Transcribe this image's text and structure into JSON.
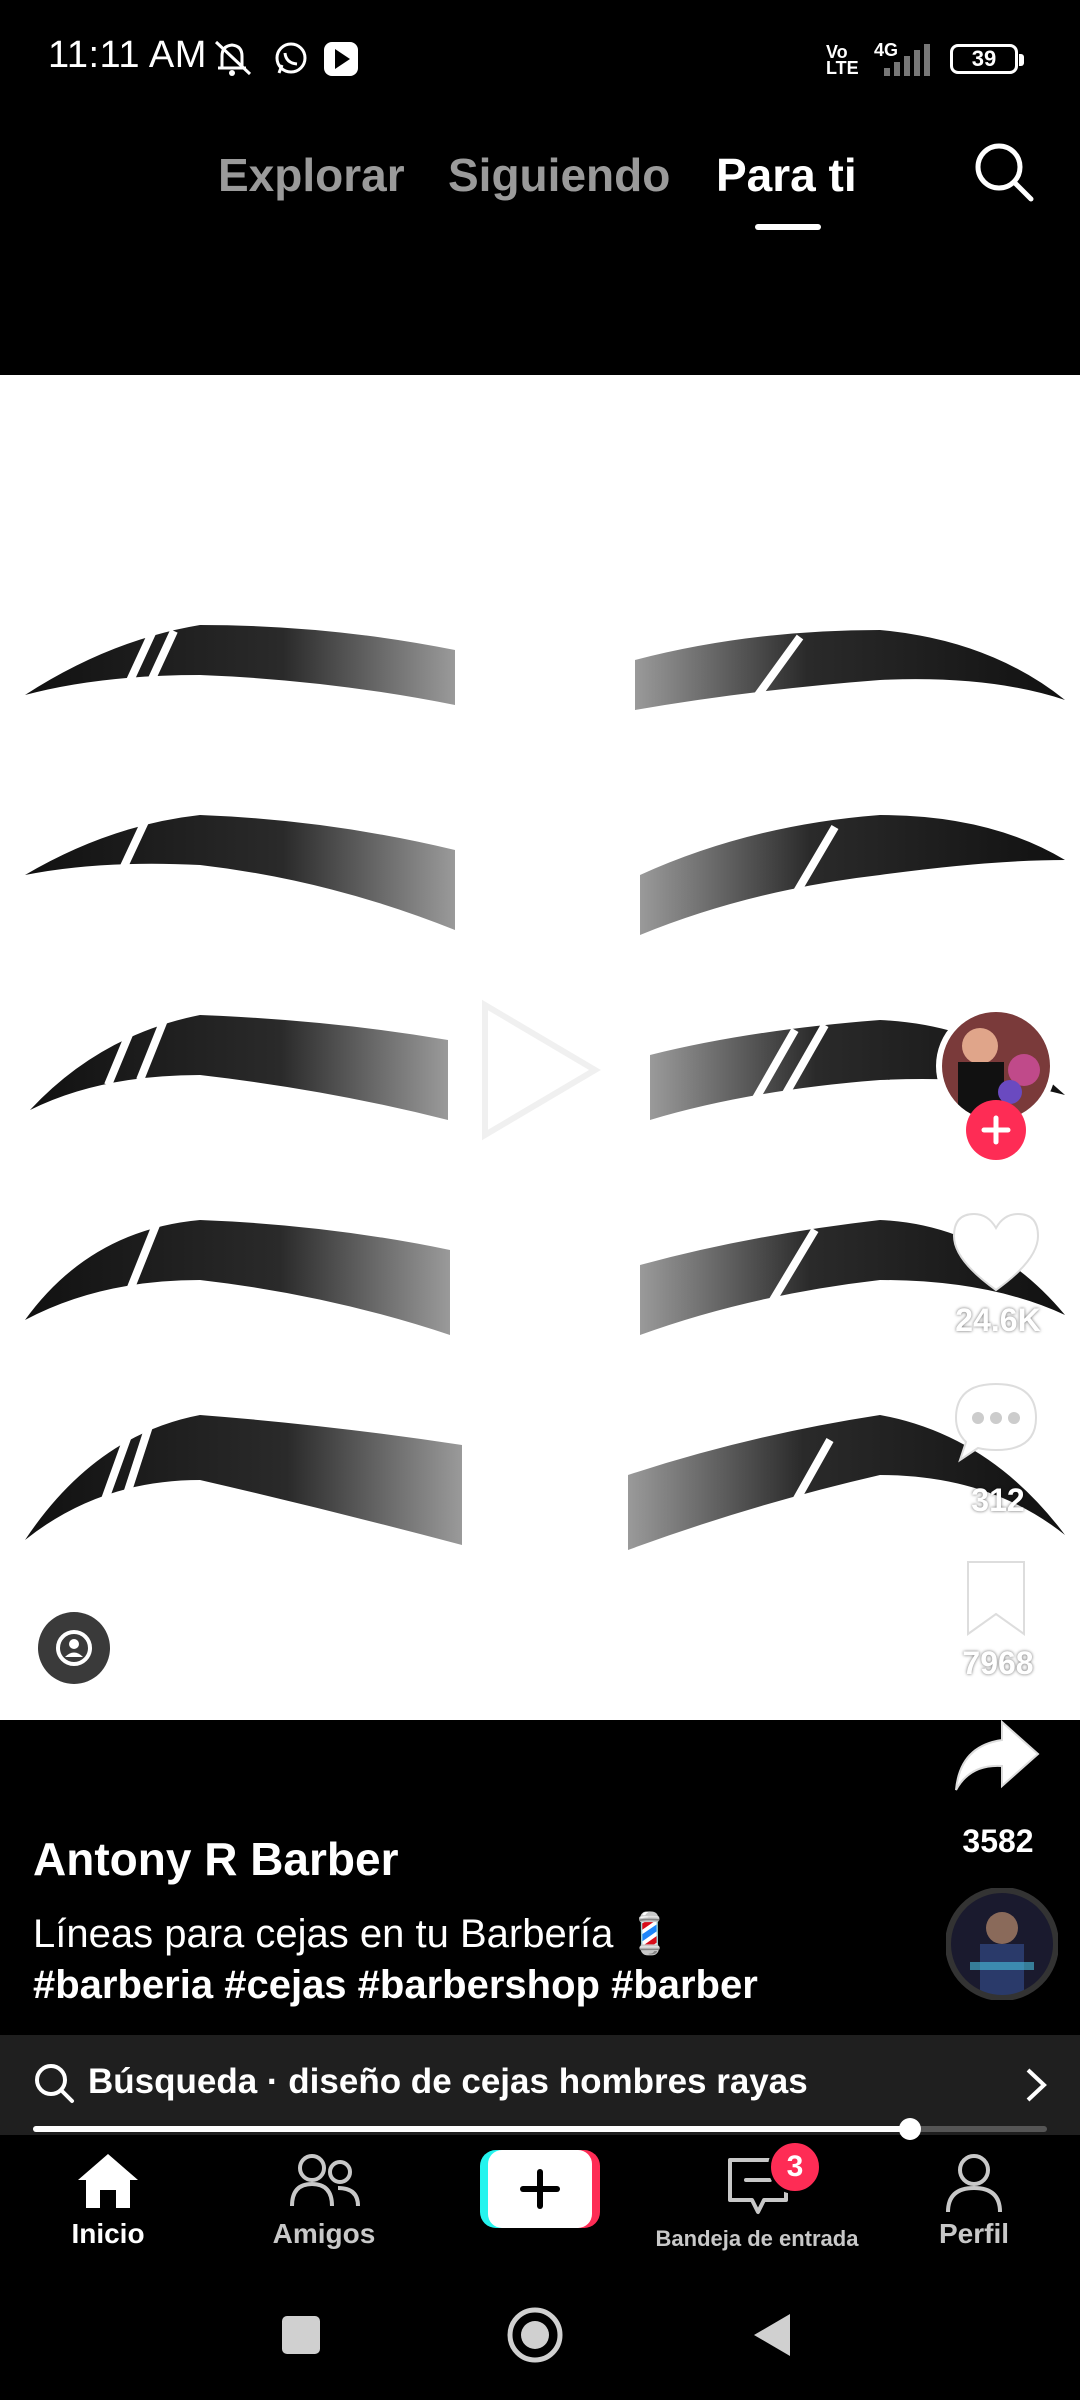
{
  "status_bar": {
    "time": "11:11 AM",
    "network_volte": "Vo LTE",
    "network_4g": "4G",
    "battery": "39"
  },
  "top_nav": {
    "tabs": [
      {
        "label": "Explorar",
        "active": false
      },
      {
        "label": "Siguiendo",
        "active": false
      },
      {
        "label": "Para ti",
        "active": true
      }
    ],
    "search_icon": "search-icon"
  },
  "video": {
    "content": "eyebrow-line-designs",
    "background": "#ffffff"
  },
  "right_rail": {
    "likes": "24.6K",
    "comments": "312",
    "saves": "7968",
    "shares": "3582"
  },
  "post": {
    "author": "Antony R Barber",
    "caption": "Líneas para cejas en tu Barbería 💈",
    "hashtags": "#barberia #cejas #barbershop #barber"
  },
  "search_suggestion": {
    "text": "Búsqueda · diseño de cejas hombres rayas"
  },
  "progress": {
    "fraction": 0.865
  },
  "bottom_nav": {
    "items": [
      {
        "label": "Inicio",
        "icon": "home-icon",
        "active": true
      },
      {
        "label": "Amigos",
        "icon": "friends-icon",
        "active": false
      },
      {
        "label": "",
        "icon": "plus-icon",
        "active": false
      },
      {
        "label": "Bandeja de entrada",
        "icon": "inbox-icon",
        "active": false
      },
      {
        "label": "Perfil",
        "icon": "profile-icon",
        "active": false
      }
    ],
    "inbox_badge": "3"
  },
  "colors": {
    "accent": "#fe2c55",
    "cyan": "#25f4ee",
    "background": "#000000"
  }
}
